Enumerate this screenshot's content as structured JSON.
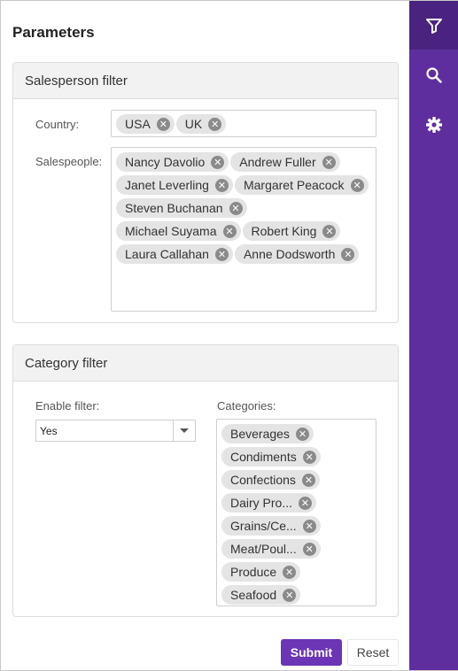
{
  "panel": {
    "title": "Parameters"
  },
  "salesperson_filter": {
    "header": "Salesperson filter",
    "country_label": "Country:",
    "countries": [
      "USA",
      "UK"
    ],
    "salespeople_label": "Salespeople:",
    "salespeople": [
      "Nancy Davolio",
      "Andrew Fuller",
      "Janet Leverling",
      "Margaret Peacock",
      "Steven Buchanan",
      "Michael Suyama",
      "Robert King",
      "Laura Callahan",
      "Anne Dodsworth"
    ]
  },
  "category_filter": {
    "header": "Category filter",
    "enable_label": "Enable filter:",
    "enable_value": "Yes",
    "categories_label": "Categories:",
    "categories": [
      "Beverages",
      "Condiments",
      "Confections",
      "Dairy Pro...",
      "Grains/Ce...",
      "Meat/Poul...",
      "Produce",
      "Seafood"
    ]
  },
  "actions": {
    "submit_label": "Submit",
    "reset_label": "Reset"
  },
  "rail": {
    "items": [
      {
        "icon": "filter-icon",
        "active": true
      },
      {
        "icon": "search-icon",
        "active": false
      },
      {
        "icon": "gear-icon",
        "active": false
      }
    ]
  },
  "colors": {
    "accent": "#6b35b5",
    "rail_bg": "#5f2e9e",
    "rail_active": "#4a2380",
    "tag_bg": "#e4e4e4"
  }
}
